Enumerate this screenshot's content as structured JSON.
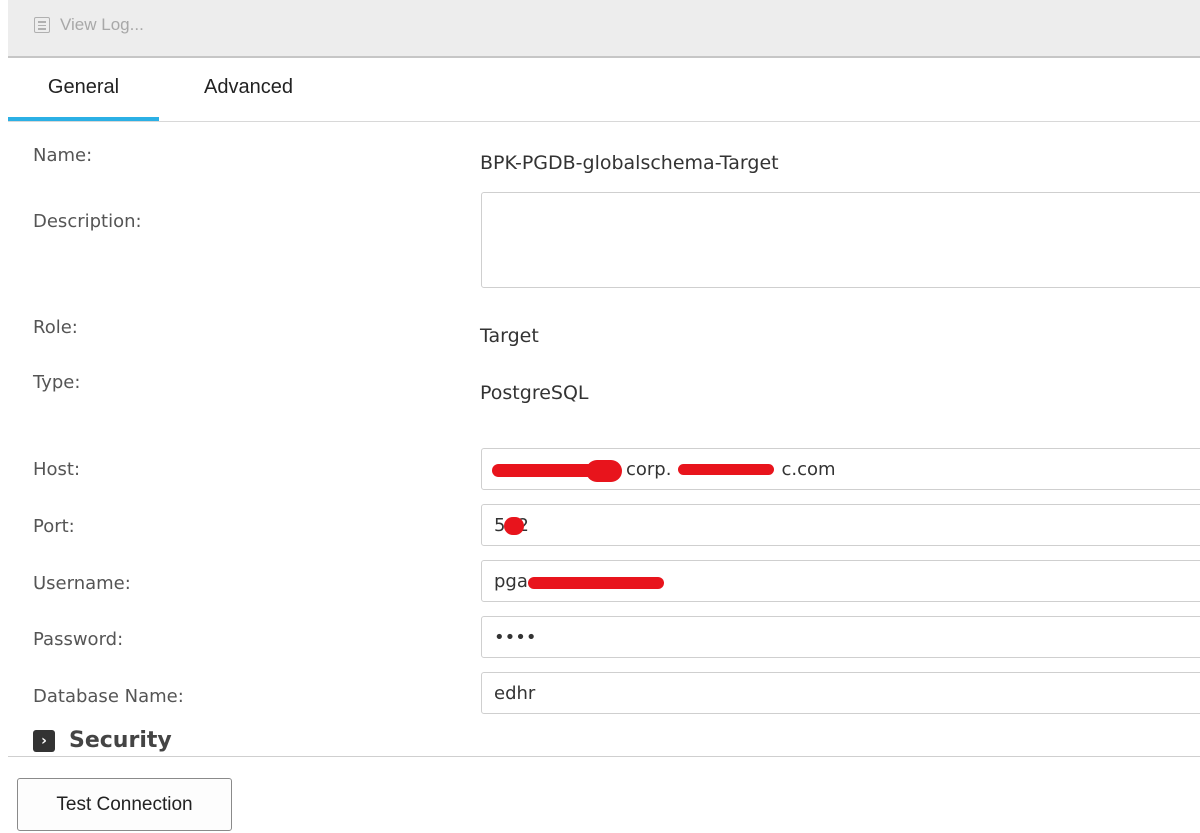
{
  "toolbar": {
    "view_log_label": "View Log...",
    "icon": "log-list-icon"
  },
  "tabs": [
    {
      "label": "General",
      "active": true
    },
    {
      "label": "Advanced",
      "active": false
    }
  ],
  "accent_color": "#2bb0e5",
  "form": {
    "name": {
      "label": "Name:",
      "value": "BPK-PGDB-globalschema-Target"
    },
    "description": {
      "label": "Description:",
      "value": ""
    },
    "role": {
      "label": "Role:",
      "value": "Target"
    },
    "type": {
      "label": "Type:",
      "value": "PostgreSQL"
    },
    "host": {
      "label": "Host:",
      "value_visible": "corp.",
      "value_visible_end": "c.com"
    },
    "port": {
      "label": "Port:",
      "value_visible_start": "5",
      "value_visible_end": "2"
    },
    "username": {
      "label": "Username:",
      "value_visible": "pga"
    },
    "password": {
      "label": "Password:",
      "value": "••••"
    },
    "database_name": {
      "label": "Database Name:",
      "value": "edhr"
    }
  },
  "security": {
    "label": "Security",
    "icon": "chevron-right-icon"
  },
  "buttons": {
    "test_connection": "Test Connection"
  }
}
